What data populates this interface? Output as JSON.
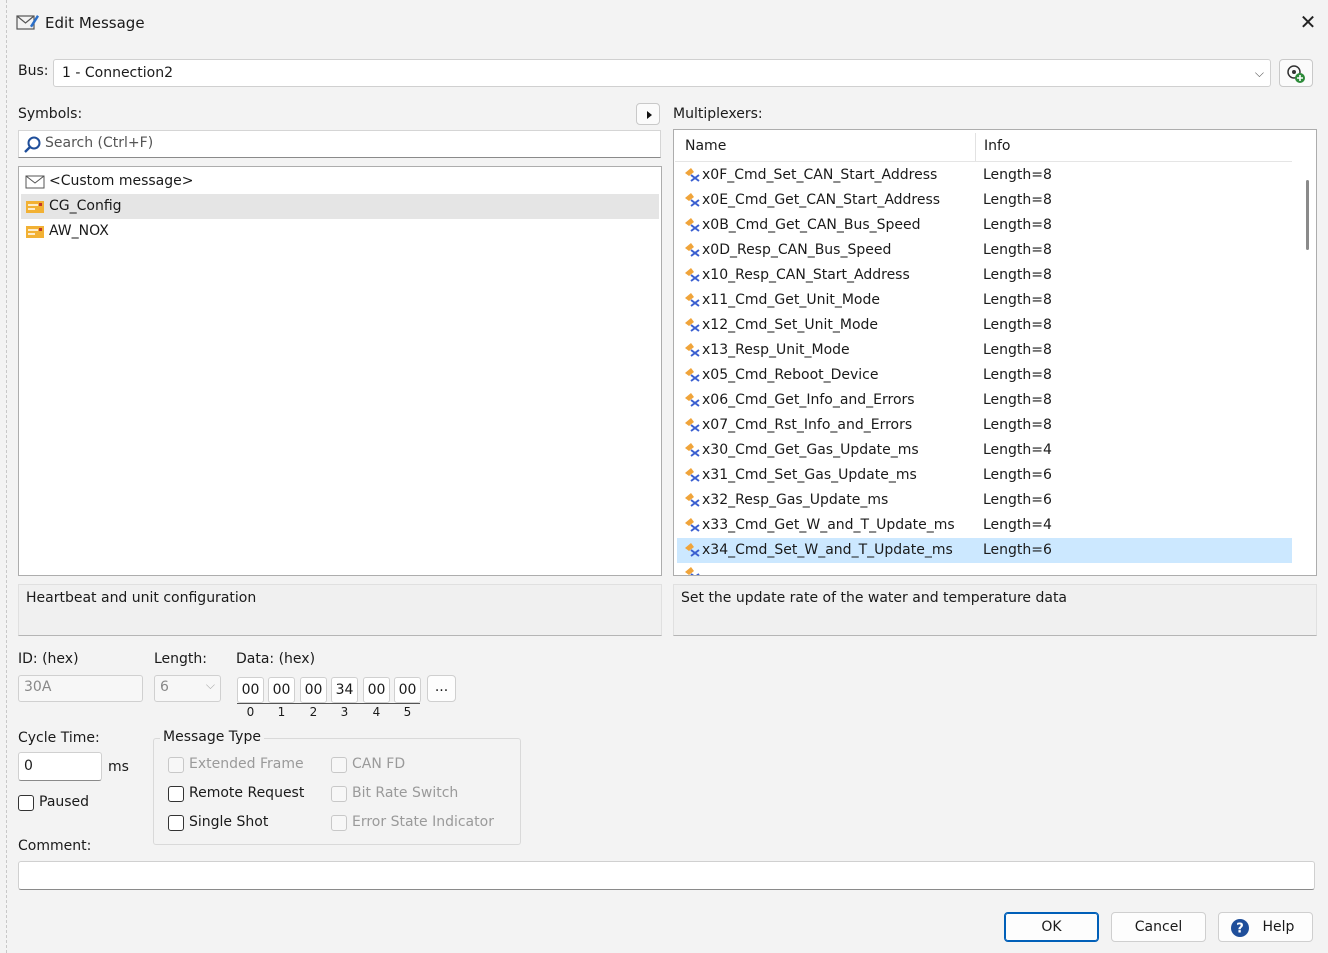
{
  "window": {
    "title": "Edit Message",
    "close_glyph": "✕"
  },
  "bus": {
    "label": "Bus:",
    "value": "1 - Connection2"
  },
  "symbols": {
    "label": "Symbols:",
    "search_placeholder": "Search (Ctrl+F)",
    "items": [
      {
        "label": "<Custom message>",
        "icon": "envelope-icon",
        "selected": false
      },
      {
        "label": "CG_Config",
        "icon": "message-symbol-icon",
        "selected": true
      },
      {
        "label": "AW_NOX",
        "icon": "message-symbol-icon",
        "selected": false
      }
    ],
    "description": "Heartbeat and unit configuration"
  },
  "multiplexers": {
    "label": "Multiplexers:",
    "columns": {
      "name": "Name",
      "info": "Info"
    },
    "rows": [
      {
        "name": "x0F_Cmd_Set_CAN_Start_Address",
        "info": "Length=8"
      },
      {
        "name": "x0E_Cmd_Get_CAN_Start_Address",
        "info": "Length=8"
      },
      {
        "name": "x0B_Cmd_Get_CAN_Bus_Speed",
        "info": "Length=8"
      },
      {
        "name": "x0D_Resp_CAN_Bus_Speed",
        "info": "Length=8"
      },
      {
        "name": "x10_Resp_CAN_Start_Address",
        "info": "Length=8"
      },
      {
        "name": "x11_Cmd_Get_Unit_Mode",
        "info": "Length=8"
      },
      {
        "name": "x12_Cmd_Set_Unit_Mode",
        "info": "Length=8"
      },
      {
        "name": "x13_Resp_Unit_Mode",
        "info": "Length=8"
      },
      {
        "name": "x05_Cmd_Reboot_Device",
        "info": "Length=8"
      },
      {
        "name": "x06_Cmd_Get_Info_and_Errors",
        "info": "Length=8"
      },
      {
        "name": "x07_Cmd_Rst_Info_and_Errors",
        "info": "Length=8"
      },
      {
        "name": "x30_Cmd_Get_Gas_Update_ms",
        "info": "Length=4"
      },
      {
        "name": "x31_Cmd_Set_Gas_Update_ms",
        "info": "Length=6"
      },
      {
        "name": "x32_Resp_Gas_Update_ms",
        "info": "Length=6"
      },
      {
        "name": "x33_Cmd_Get_W_and_T_Update_ms",
        "info": "Length=4"
      },
      {
        "name": "x34_Cmd_Set_W_and_T_Update_ms",
        "info": "Length=6",
        "selected": true
      }
    ],
    "description": "Set the update rate of the water and temperature data"
  },
  "fields": {
    "id_label": "ID: (hex)",
    "id_value": "30A",
    "length_label": "Length:",
    "length_value": "6",
    "data_label": "Data: (hex)",
    "data_bytes": [
      "00",
      "00",
      "00",
      "34",
      "00",
      "00"
    ],
    "data_indices": [
      "0",
      "1",
      "2",
      "3",
      "4",
      "5"
    ],
    "data_more": "...",
    "cycle_label": "Cycle Time:",
    "cycle_value": "0",
    "cycle_unit": "ms",
    "paused_label": "Paused",
    "comment_label": "Comment:"
  },
  "message_type": {
    "title": "Message Type",
    "extended_frame": "Extended Frame",
    "remote_request": "Remote Request",
    "single_shot": "Single Shot",
    "can_fd": "CAN FD",
    "bit_rate_switch": "Bit Rate Switch",
    "error_state_indicator": "Error State Indicator"
  },
  "buttons": {
    "ok": "OK",
    "cancel": "Cancel",
    "help": "Help"
  },
  "colors": {
    "selection": "#cce8ff",
    "accent": "#005fb8"
  }
}
